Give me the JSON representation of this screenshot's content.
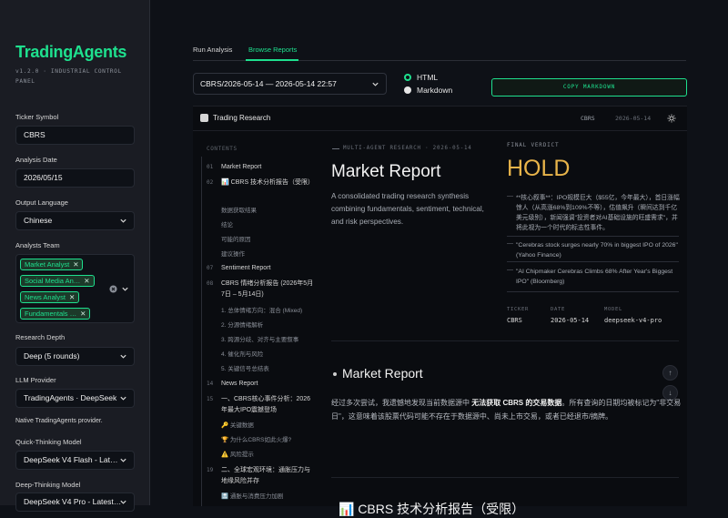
{
  "sidebar": {
    "brand": "TradingAgents",
    "tagline": "v1.2.0 · INDUSTRIAL CONTROL PANEL",
    "ticker_label": "Ticker Symbol",
    "ticker_value": "CBRS",
    "date_label": "Analysis Date",
    "date_value": "2026/05/15",
    "lang_label": "Output Language",
    "lang_value": "Chinese",
    "team_label": "Analysts Team",
    "team_tags": [
      "Market Analyst",
      "Social Media An…",
      "News Analyst",
      "Fundamentals …"
    ],
    "depth_label": "Research Depth",
    "depth_value": "Deep (5 rounds)",
    "provider_label": "LLM Provider",
    "provider_value": "TradingAgents · DeepSeek",
    "provider_note": "Native TradingAgents provider.",
    "quick_label": "Quick-Thinking Model",
    "quick_value": "DeepSeek V4 Flash - Lat…",
    "deep_label": "Deep-Thinking Model",
    "deep_value": "DeepSeek V4 Pro - Latest…"
  },
  "tabs": [
    "Run Analysis",
    "Browse Reports"
  ],
  "report_select": "CBRS/2026-05-14 — 2026-05-14 22:57",
  "format": {
    "html": "HTML",
    "markdown": "Markdown",
    "selected": "HTML"
  },
  "copy_label": "COPY MARKDOWN",
  "panel": {
    "title": "Trading Research",
    "ticker": "CBRS",
    "date": "2026-05-14",
    "contents_heading": "CONTENTS",
    "toc": [
      {
        "n": "01",
        "t": "Market Report"
      },
      {
        "n": "02",
        "t": "📊 CBRS 技术分析报告（受限）"
      },
      {
        "n": "07",
        "t": "Sentiment Report"
      },
      {
        "n": "08",
        "t": "CBRS 情绪分析报告 (2026年5月7日 – 5月14日)"
      },
      {
        "n": "14",
        "t": "News Report"
      },
      {
        "n": "15",
        "t": "一、CBRS核心事件分析：2026年最大IPO震撼登场"
      },
      {
        "n": "19",
        "t": "二、全球宏观环境：通胀压力与地缘风险并存"
      }
    ],
    "toc_sub_a": [
      "数据获取结果",
      "结论",
      "可能的原因",
      "建议操作"
    ],
    "toc_sub_b": [
      "1. 总体情绪方向：混合 (Mixed)",
      "2. 分源情绪解析",
      "3. 跨源分歧、对齐与主要叙事",
      "4. 催化剂与风险",
      "5. 关键信号总结表"
    ],
    "toc_sub_c": [
      "🔑 关键数据",
      "🏆 为什么CBRS如此火爆?",
      "⚠️ 风险提示"
    ],
    "toc_sub_d": "🔝 通胀与消费压力加剧",
    "kicker": "MULTI-AGENT RESEARCH · 2026-05-14",
    "report_title": "Market Report",
    "report_sub": "A consolidated trading research synthesis combining fundamentals, sentiment, technical, and risk perspectives.",
    "verdict_label": "FINAL VERDICT",
    "verdict": "HOLD",
    "bullets": [
      "**核心叙事**：IPO规模巨大（$55亿，今年最大），首日涨幅惊人（从高涨68%到109%不等），估值飙升（瞬间达到千亿美元级别），新闻强调\"投资者对AI基础设施的旺盛需求\"，并将此视为一个时代的标志性事件。",
      "\"Cerebras stock surges nearly 70% in biggest IPO of 2026\" (Yahoo Finance)",
      "\"AI Chipmaker Cerebras Climbs 68% After Year's Biggest IPO\" (Bloomberg)"
    ],
    "meta": {
      "ticker_h": "TICKER",
      "ticker_v": "CBRS",
      "date_h": "DATE",
      "date_v": "2026-05-14",
      "model_h": "MODEL",
      "model_v": "deepseek-v4-pro"
    },
    "section_title": "Market Report",
    "para_pre": "经过多次尝试，我遗憾地发现当前数据源中 ",
    "para_bold": "无法获取 CBRS 的交易数据",
    "para_post": "。所有查询的日期均被标记为\"非交易日\"，这意味着该股票代码可能不存在于数据源中、尚未上市交易，或者已经退市/摘牌。",
    "section2_title": "📊 CBRS 技术分析报告（受限）"
  },
  "colors": {
    "accent": "#1ee08e",
    "verdict": "#e8b44a",
    "bg": "#0e1117",
    "sidebar": "#1a1c23"
  }
}
